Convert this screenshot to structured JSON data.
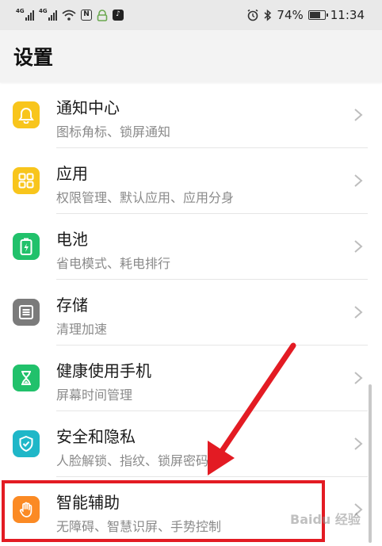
{
  "status_bar": {
    "sig1_label": "4G",
    "sig2_label": "4G",
    "nfc_label": "N",
    "battery_percent": "74%",
    "battery_level": 0.74,
    "time": "11:34"
  },
  "header": {
    "title": "设置"
  },
  "items": [
    {
      "label": "通知中心",
      "sub": "图标角标、锁屏通知",
      "icon": "bell-icon",
      "color": "#f8c51c"
    },
    {
      "label": "应用",
      "sub": "权限管理、默认应用、应用分身",
      "icon": "apps-grid-icon",
      "color": "#f8c51c"
    },
    {
      "label": "电池",
      "sub": "省电模式、耗电排行",
      "icon": "battery-icon",
      "color": "#21c16b"
    },
    {
      "label": "存储",
      "sub": "清理加速",
      "icon": "storage-icon",
      "color": "#7b7b7b"
    },
    {
      "label": "健康使用手机",
      "sub": "屏幕时间管理",
      "icon": "hourglass-icon",
      "color": "#21c16b"
    },
    {
      "label": "安全和隐私",
      "sub": "人脸解锁、指纹、锁屏密码",
      "icon": "shield-check-icon",
      "color": "#1fb7c8"
    },
    {
      "label": "智能辅助",
      "sub": "无障碍、智慧识屏、手势控制",
      "icon": "hand-icon",
      "color": "#fb8a24"
    }
  ],
  "annotation_color": "#e31b23",
  "watermark": "Baidu 经验"
}
